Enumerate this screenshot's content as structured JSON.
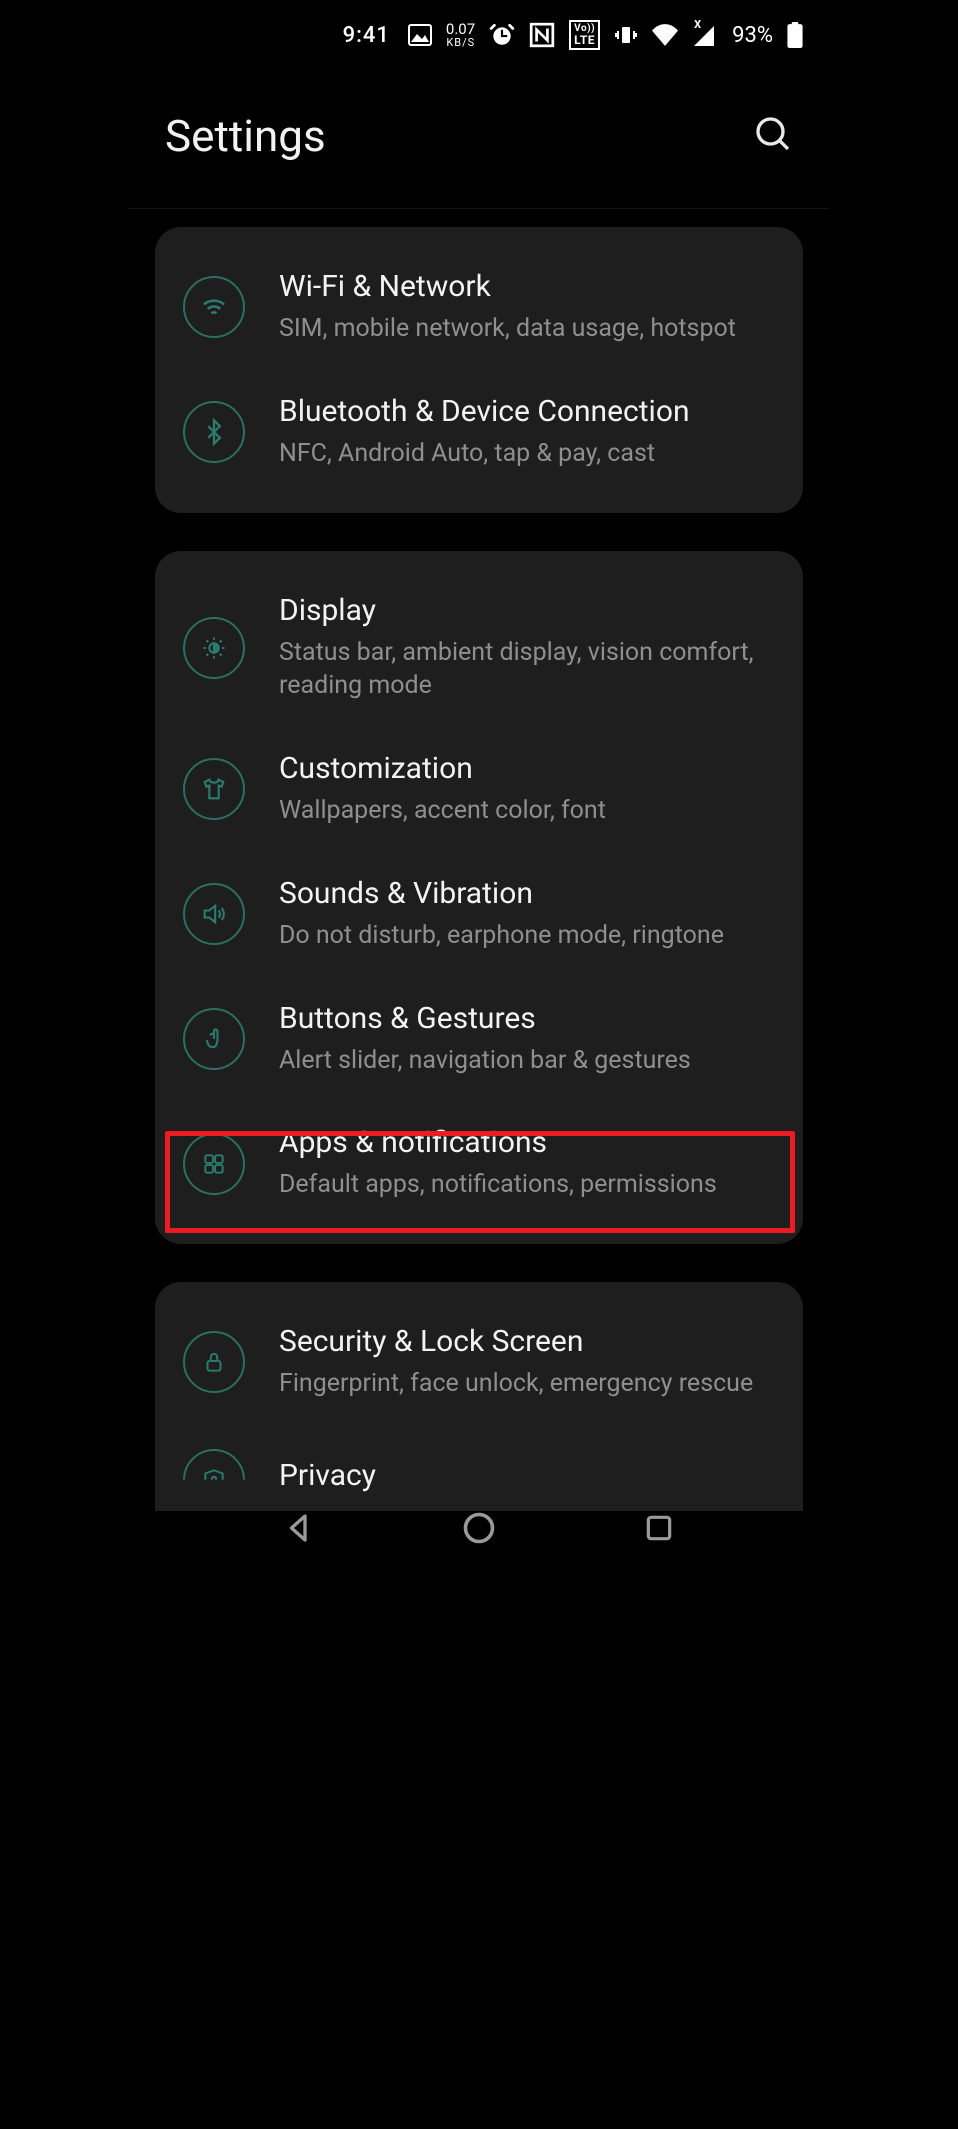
{
  "status": {
    "time": "9:41",
    "data_rate_top": "0.07",
    "data_rate_bot": "KB/S",
    "volte_top": "Vo))",
    "volte_bot": "LTE",
    "signal_x": "X",
    "battery_pct": "93%"
  },
  "header": {
    "title": "Settings"
  },
  "groups": [
    {
      "items": [
        {
          "icon": "wifi",
          "title": "Wi-Fi & Network",
          "sub": "SIM, mobile network, data usage, hotspot"
        },
        {
          "icon": "bluetooth",
          "title": "Bluetooth & Device Connection",
          "sub": "NFC, Android Auto, tap & pay, cast"
        }
      ]
    },
    {
      "items": [
        {
          "icon": "brightness",
          "title": "Display",
          "sub": "Status bar, ambient display, vision comfort, reading mode"
        },
        {
          "icon": "tshirt",
          "title": "Customization",
          "sub": "Wallpapers, accent color, font"
        },
        {
          "icon": "sound",
          "title": "Sounds & Vibration",
          "sub": "Do not disturb, earphone mode, ringtone"
        },
        {
          "icon": "gesture",
          "title": "Buttons & Gestures",
          "sub": "Alert slider, navigation bar & gestures"
        },
        {
          "icon": "apps",
          "title": "Apps & notifications",
          "sub": "Default apps, notifications, permissions",
          "highlighted": true
        }
      ]
    },
    {
      "items": [
        {
          "icon": "lock",
          "title": "Security & Lock Screen",
          "sub": "Fingerprint, face unlock, emergency rescue"
        },
        {
          "icon": "privacy",
          "title": "Privacy",
          "sub": ""
        }
      ]
    }
  ]
}
